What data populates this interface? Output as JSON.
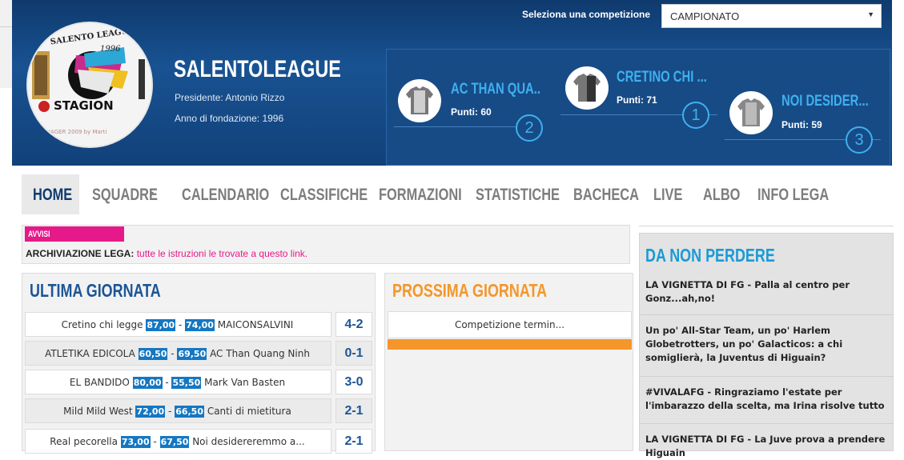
{
  "header": {
    "select_label": "Seleziona una competizione",
    "select_value": "CAMPIONATO",
    "league_name": "SALENTOLEAGUE",
    "presidente_label": "Presidente:",
    "presidente_value": "Antonio Rizzo",
    "fondazione_label": "Anno di fondazione:",
    "fondazione_value": "1996",
    "logo_text_top": "SALENTO LEAGUE",
    "logo_year": "1996",
    "logo_text_mid": "STAGION",
    "logo_text_bottom": "ANAGER 2009 by Marti"
  },
  "podium": [
    {
      "rank": "2",
      "name": "AC THAN QUA..",
      "points": "Punti: 60"
    },
    {
      "rank": "1",
      "name": "CRETINO CHI ...",
      "points": "Punti: 71"
    },
    {
      "rank": "3",
      "name": "NOI DESIDER...",
      "points": "Punti: 59"
    }
  ],
  "nav": [
    "HOME",
    "SQUADRE",
    "CALENDARIO",
    "CLASSIFICHE",
    "FORMAZIONI",
    "STATISTICHE",
    "BACHECA",
    "LIVE",
    "ALBO",
    "INFO LEGA"
  ],
  "avvisi": {
    "tag": "AVVISI",
    "label": "ARCHIVIAZIONE LEGA:",
    "link_text": "tutte le istruzioni le trovate a questo link."
  },
  "ultima": {
    "title": "ULTIMA GIORNATA",
    "matches": [
      {
        "home": "Cretino chi legge",
        "home_pts": "87,00",
        "away_pts": "74,00",
        "away": "MAICONSALVINI",
        "result": "4-2"
      },
      {
        "home": "ATLETIKA EDICOLA",
        "home_pts": "60,50",
        "away_pts": "69,50",
        "away": "AC Than Quang Ninh",
        "result": "0-1"
      },
      {
        "home": "EL BANDIDO",
        "home_pts": "80,00",
        "away_pts": "55,50",
        "away": "Mark Van Basten",
        "result": "3-0"
      },
      {
        "home": "Mild Mild West",
        "home_pts": "72,00",
        "away_pts": "66,50",
        "away": "Canti di mietitura",
        "result": "2-1"
      },
      {
        "home": "Real pecorella",
        "home_pts": "73,00",
        "away_pts": "67,50",
        "away": "Noi desidereremmo a...",
        "result": "2-1"
      }
    ]
  },
  "prossima": {
    "title": "PROSSIMA GIORNATA",
    "status": "Competizione termin..."
  },
  "side": {
    "title": "DA NON PERDERE",
    "items": [
      "LA VIGNETTA DI FG - Palla al centro per Gonz...ah,no!",
      "Un po' All-Star Team, un po' Harlem Globetrotters, un po' Galacticos: a chi somiglierà, la Juventus di Higuain?",
      "#VIVALAFG - Ringraziamo l'estate per l'imbarazzo della scelta, ma Irina risolve tutto",
      "LA VIGNETTA DI FG - La Juve prova a prendere Higuain"
    ]
  },
  "colors": {
    "brand_blue": "#185292",
    "accent_pink": "#e5198a",
    "accent_orange": "#f4962a",
    "score_blue": "#1577c2"
  }
}
